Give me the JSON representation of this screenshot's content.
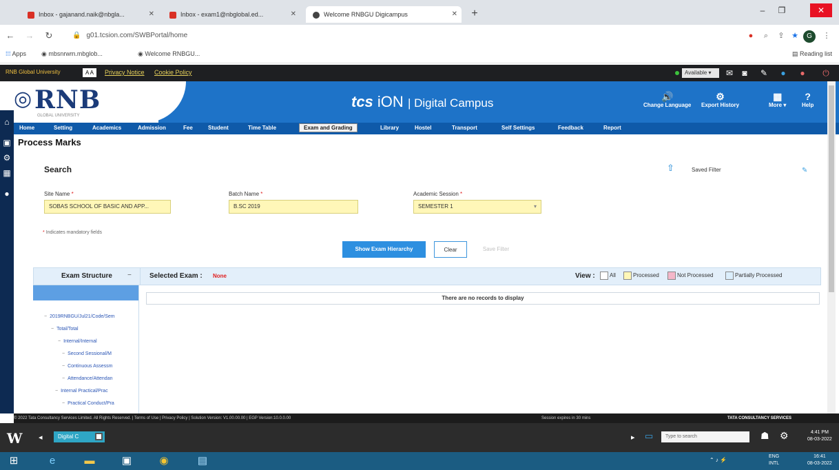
{
  "browser": {
    "tabs": [
      {
        "title": "Inbox - gajanand.naik@nbgla...",
        "active": false,
        "icon": "gmail-icon"
      },
      {
        "title": "Inbox - exam1@nbglobal.ed...",
        "active": false,
        "icon": "gmail-icon"
      },
      {
        "title": "Welcome RNBGU Digicampus",
        "active": true,
        "icon": "chrome-icon"
      }
    ],
    "url": "g01.tcsion.com/SWBPortal/home",
    "bookmarks": {
      "apps": "Apps",
      "b1": "mbsnrwm.mbglob...",
      "b2": "Welcome RNBGU...",
      "reading_list": "Reading list"
    }
  },
  "site_topbar": {
    "university": "RNB Global University",
    "privacy": "Privacy Notice",
    "cookie": "Cookie Policy",
    "status_select": "Available"
  },
  "header": {
    "logo": "RNB",
    "logo_sub": "GLOBAL UNIVERSITY",
    "brand_tcs": "tcs",
    "brand_ion": "iON",
    "brand_rest": "| Digital Campus",
    "change_language": "Change Language",
    "export_history": "Export History",
    "more": "More",
    "help": "Help"
  },
  "menu": {
    "items": [
      "Home",
      "Setting",
      "Academics",
      "Admission",
      "Fee",
      "Student",
      "Time Table",
      "Exam and Grading",
      "Library",
      "Hostel",
      "Transport",
      "Self Settings",
      "Feedback",
      "Report"
    ],
    "active_index": 7
  },
  "page": {
    "title": "Process Marks",
    "search_label": "Search",
    "saved_filter": "Saved Filter",
    "fields": {
      "site_label": "Site Name",
      "site_value": "SOBAS SCHOOL OF BASIC AND APP...",
      "batch_label": "Batch Name",
      "batch_value": "B.SC 2019",
      "semester_label": "Academic Session",
      "semester_value": "SEMESTER 1"
    },
    "required_note": "Indicates mandatory fields",
    "buttons": {
      "show": "Show Exam Hierarchy",
      "clear": "Clear",
      "save_filter": "Save Filter"
    }
  },
  "panel": {
    "exam_structure": "Exam Structure",
    "selected_exam": "Selected Exam :",
    "selected_value": "None",
    "view_label": "View :",
    "legend": [
      "All",
      "Processed",
      "Not Processed",
      "Partially Processed"
    ],
    "no_records": "There are no records to display",
    "tree": [
      {
        "label": "2019RNBGU/Jul21/Code/Sem",
        "depth": 0
      },
      {
        "label": "Total/Total",
        "depth": 1
      },
      {
        "label": "Internal/Internal",
        "depth": 2
      },
      {
        "label": "Second Sessional/M",
        "depth": 3
      },
      {
        "label": "Continuous Assessm",
        "depth": 3
      },
      {
        "label": "Attendance/Attendan",
        "depth": 3
      },
      {
        "label": "Internal Practical/Prac",
        "depth": 2
      },
      {
        "label": "Practical Conduct/Pra",
        "depth": 3
      }
    ]
  },
  "footer": {
    "copyright": "© 2022 Tata Consultancy Services Limited. All Rights Reserved. | Terms of Use | Privacy Policy | Solution Version: V1.00.00.00 | EGP Version:10.0.0.00",
    "session": "Session expires in 30 mins",
    "tcs": "TATA CONSULTANCY SERVICES"
  },
  "remote_bar": {
    "tab": "Digital C",
    "search": "Type to search",
    "time": "4:41 PM",
    "date": "08-03-2022"
  },
  "taskbar": {
    "lang": "ENG",
    "region": "INTL",
    "time": "16:41",
    "date": "08-03-2022"
  },
  "colors": {
    "header_blue": "#1e73c8",
    "menu_blue": "#0f5aa9",
    "input_yellow": "#fff7b8",
    "primary_button": "#2d8fe0",
    "not_processed_pink": "#f4b7c9",
    "processed_yellow": "#fff7b8",
    "partial_blue": "#dbeefc"
  }
}
